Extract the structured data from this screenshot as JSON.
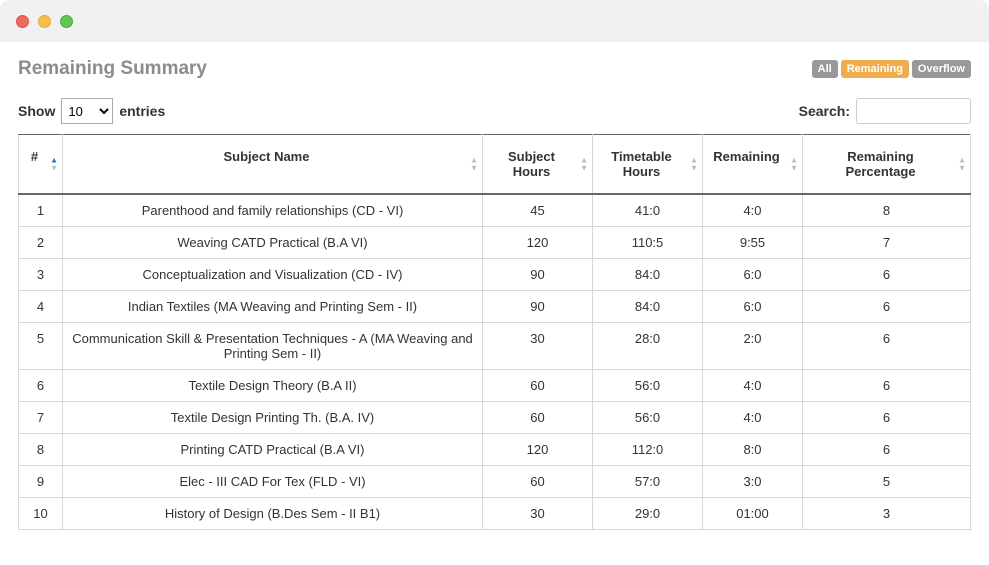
{
  "page": {
    "title": "Remaining Summary"
  },
  "filters": {
    "all": "All",
    "remaining": "Remaining",
    "overflow": "Overflow"
  },
  "controls": {
    "show_label_pre": "Show",
    "show_label_post": "entries",
    "show_value": "10",
    "search_label": "Search:",
    "search_value": ""
  },
  "table": {
    "headers": {
      "idx": "#",
      "name": "Subject Name",
      "subject_hours": "Subject Hours",
      "timetable_hours": "Timetable Hours",
      "remaining": "Remaining",
      "remaining_pct": "Remaining Percentage"
    },
    "rows": [
      {
        "n": "1",
        "name": "Parenthood and family relationships (CD - VI)",
        "sh": "45",
        "th": "41:0",
        "rem": "4:0",
        "pct": "8"
      },
      {
        "n": "2",
        "name": "Weaving CATD Practical (B.A VI)",
        "sh": "120",
        "th": "110:5",
        "rem": "9:55",
        "pct": "7"
      },
      {
        "n": "3",
        "name": "Conceptualization and Visualization (CD - IV)",
        "sh": "90",
        "th": "84:0",
        "rem": "6:0",
        "pct": "6"
      },
      {
        "n": "4",
        "name": "Indian Textiles (MA Weaving and Printing Sem - II)",
        "sh": "90",
        "th": "84:0",
        "rem": "6:0",
        "pct": "6"
      },
      {
        "n": "5",
        "name": "Communication Skill & Presentation Techniques - A (MA Weaving and Printing Sem - II)",
        "sh": "30",
        "th": "28:0",
        "rem": "2:0",
        "pct": "6"
      },
      {
        "n": "6",
        "name": "Textile Design Theory (B.A II)",
        "sh": "60",
        "th": "56:0",
        "rem": "4:0",
        "pct": "6"
      },
      {
        "n": "7",
        "name": "Textile Design Printing Th. (B.A. IV)",
        "sh": "60",
        "th": "56:0",
        "rem": "4:0",
        "pct": "6"
      },
      {
        "n": "8",
        "name": "Printing CATD Practical (B.A VI)",
        "sh": "120",
        "th": "112:0",
        "rem": "8:0",
        "pct": "6"
      },
      {
        "n": "9",
        "name": "Elec - III CAD For Tex (FLD - VI)",
        "sh": "60",
        "th": "57:0",
        "rem": "3:0",
        "pct": "5"
      },
      {
        "n": "10",
        "name": "History of Design (B.Des Sem - II B1)",
        "sh": "30",
        "th": "29:0",
        "rem": "01:00",
        "pct": "3"
      }
    ]
  }
}
